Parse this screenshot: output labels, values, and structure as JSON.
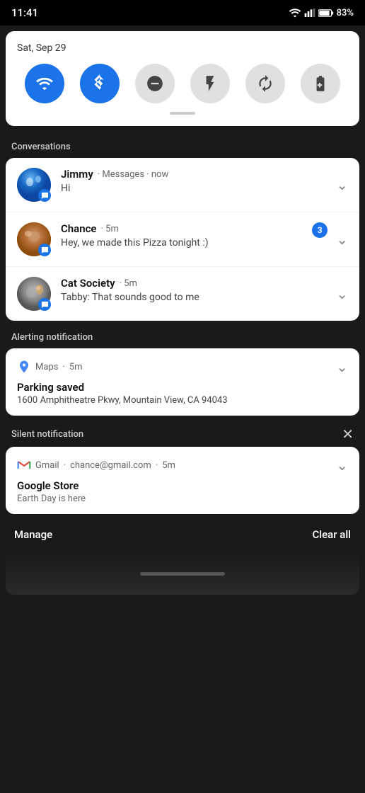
{
  "statusBar": {
    "time": "11:41",
    "battery": "83%"
  },
  "quickSettings": {
    "date": "Sat, Sep 29",
    "toggles": [
      {
        "id": "wifi",
        "label": "Wi-Fi",
        "active": true
      },
      {
        "id": "bluetooth",
        "label": "Bluetooth",
        "active": true
      },
      {
        "id": "dnd",
        "label": "Do Not Disturb",
        "active": false
      },
      {
        "id": "flashlight",
        "label": "Flashlight",
        "active": false
      },
      {
        "id": "rotate",
        "label": "Auto Rotate",
        "active": false
      },
      {
        "id": "battery_saver",
        "label": "Battery Saver",
        "active": false
      }
    ]
  },
  "sections": {
    "conversations": {
      "label": "Conversations",
      "items": [
        {
          "name": "Jimmy",
          "app": "Messages",
          "time": "now",
          "message": "Hi",
          "badge": null
        },
        {
          "name": "Chance",
          "app": "Messages",
          "time": "5m",
          "message": "Hey, we made this Pizza tonight :)",
          "badge": "3"
        },
        {
          "name": "Cat Society",
          "app": "Messages",
          "time": "5m",
          "message": "Tabby: That sounds good to me",
          "badge": null
        }
      ]
    },
    "alerting": {
      "label": "Alerting notification",
      "app": "Maps",
      "time": "5m",
      "title": "Parking saved",
      "body": "1600 Amphitheatre Pkwy, Mountain View, CA 94043"
    },
    "silent": {
      "label": "Silent notification",
      "app": "Gmail",
      "email": "chance@gmail.com",
      "time": "5m",
      "title": "Google Store",
      "body": "Earth Day is here"
    }
  },
  "bottomBar": {
    "manage": "Manage",
    "clearAll": "Clear all"
  },
  "convMetaSeparator": "·",
  "bullet": "·"
}
